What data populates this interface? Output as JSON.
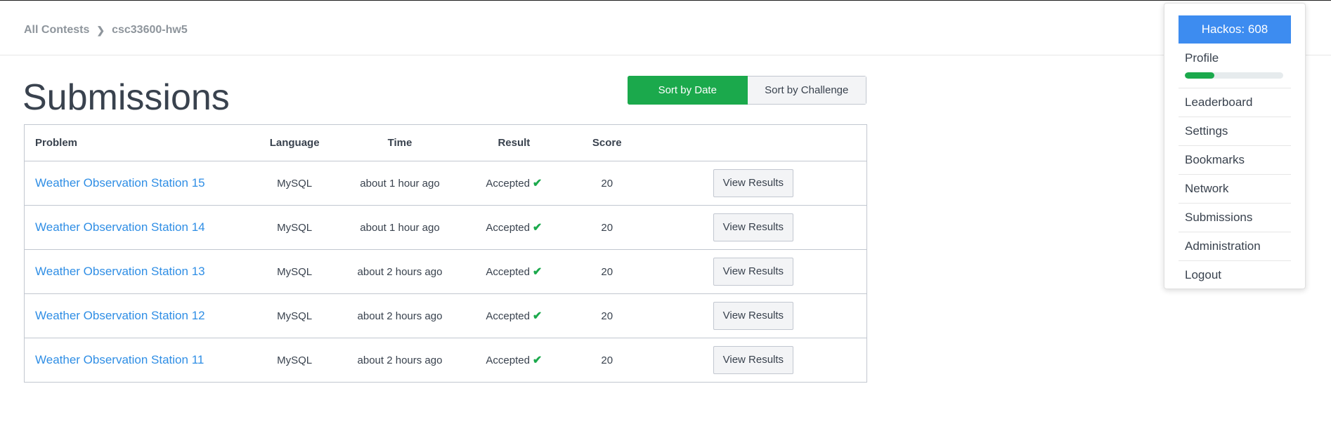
{
  "breadcrumb": {
    "parent": "All Contests",
    "current": "csc33600-hw5"
  },
  "page": {
    "title": "Submissions"
  },
  "sort": {
    "by_date": "Sort by Date",
    "by_challenge": "Sort by Challenge"
  },
  "table": {
    "headers": {
      "problem": "Problem",
      "language": "Language",
      "time": "Time",
      "result": "Result",
      "score": "Score"
    },
    "rows": [
      {
        "problem": "Weather Observation Station 15",
        "language": "MySQL",
        "time": "about 1 hour ago",
        "result": "Accepted",
        "score": "20",
        "action": "View Results"
      },
      {
        "problem": "Weather Observation Station 14",
        "language": "MySQL",
        "time": "about 1 hour ago",
        "result": "Accepted",
        "score": "20",
        "action": "View Results"
      },
      {
        "problem": "Weather Observation Station 13",
        "language": "MySQL",
        "time": "about 2 hours ago",
        "result": "Accepted",
        "score": "20",
        "action": "View Results"
      },
      {
        "problem": "Weather Observation Station 12",
        "language": "MySQL",
        "time": "about 2 hours ago",
        "result": "Accepted",
        "score": "20",
        "action": "View Results"
      },
      {
        "problem": "Weather Observation Station 11",
        "language": "MySQL",
        "time": "about 2 hours ago",
        "result": "Accepted",
        "score": "20",
        "action": "View Results"
      }
    ]
  },
  "dropdown": {
    "hackos": "Hackos: 608",
    "profile": "Profile",
    "profile_progress": 0.3,
    "items": [
      "Leaderboard",
      "Settings",
      "Bookmarks",
      "Network",
      "Submissions",
      "Administration",
      "Logout"
    ]
  },
  "icons": {
    "breadcrumb_separator": "chevron-right-icon",
    "result_status": "check-icon"
  },
  "colors": {
    "accent_green": "#1ba94c",
    "link_blue": "#2f8ee5",
    "hackos_blue": "#3d8cf0"
  }
}
